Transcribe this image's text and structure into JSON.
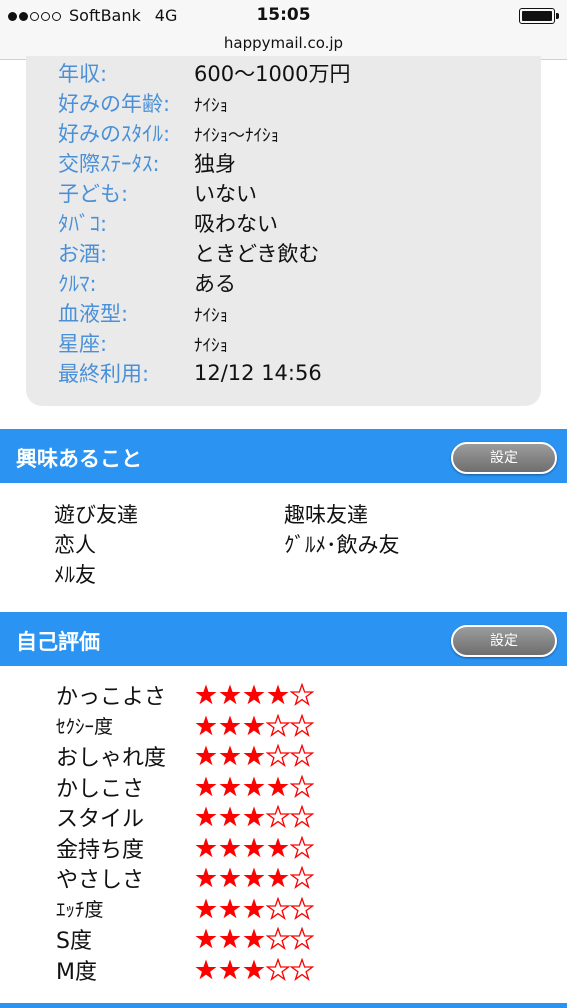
{
  "status_bar": {
    "signal_dots": [
      true,
      true,
      false,
      false,
      false
    ],
    "carrier": "SoftBank",
    "network": "4G",
    "time": "15:05",
    "battery_level": 1.0
  },
  "url": "happymail.co.jp",
  "profile": [
    {
      "label": "年収:",
      "value": "600〜1000万円"
    },
    {
      "label": "好みの年齢:",
      "value": "ﾅｲｼｮ"
    },
    {
      "label": "好みのｽﾀｲﾙ:",
      "value": "ﾅｲｼｮ〜ﾅｲｼｮ"
    },
    {
      "label": "交際ｽﾃｰﾀｽ:",
      "value": "独身"
    },
    {
      "label": "子ども:",
      "value": "いない"
    },
    {
      "label": "ﾀﾊﾞｺ:",
      "value": "吸わない"
    },
    {
      "label": "お酒:",
      "value": "ときどき飲む"
    },
    {
      "label": "ｸﾙﾏ:",
      "value": "ある"
    },
    {
      "label": "血液型:",
      "value": "ﾅｲｼｮ"
    },
    {
      "label": "星座:",
      "value": "ﾅｲｼｮ"
    },
    {
      "label": "最終利用:",
      "value": "12/12 14:56"
    }
  ],
  "interests_section": {
    "title": "興味あること",
    "button_label": "設定",
    "items": [
      "遊び友達",
      "趣味友達",
      "恋人",
      "ｸﾞﾙﾒ･飲み友",
      "ﾒﾙ友"
    ]
  },
  "self_rating_section": {
    "title": "自己評価",
    "button_label": "設定",
    "max_stars": 5,
    "items": [
      {
        "label": "かっこよさ",
        "stars": 4
      },
      {
        "label": "ｾｸｼｰ度",
        "stars": 3
      },
      {
        "label": "おしゃれ度",
        "stars": 3
      },
      {
        "label": "かしこさ",
        "stars": 4
      },
      {
        "label": "スタイル",
        "stars": 3
      },
      {
        "label": "金持ち度",
        "stars": 4
      },
      {
        "label": "やさしさ",
        "stars": 4
      },
      {
        "label": "ｴｯﾁ度",
        "stars": 3
      },
      {
        "label": "S度",
        "stars": 3
      },
      {
        "label": "M度",
        "stars": 3
      }
    ]
  },
  "colors": {
    "accent": "#2b93f2",
    "label_blue": "#4a90d8",
    "star_red": "#ff0000"
  }
}
